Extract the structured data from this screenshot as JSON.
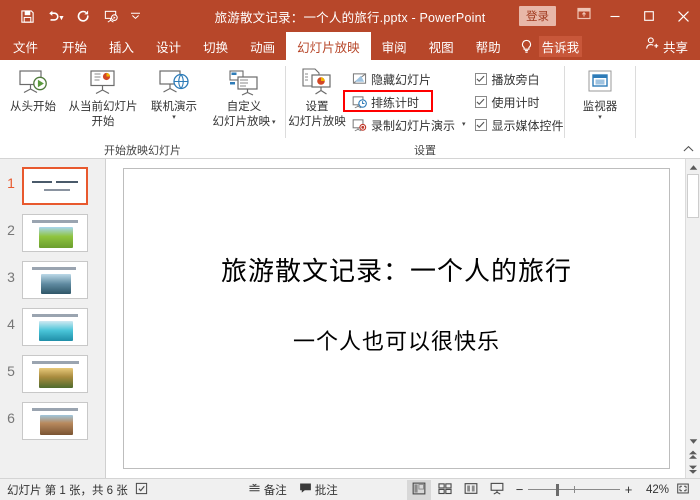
{
  "theme": {
    "accent": "#b7472a",
    "selection": "#e8592e",
    "highlight": "#ff0000"
  },
  "titlebar": {
    "document_title": "旅游散文记录：一个人的旅行.pptx  -  PowerPoint",
    "quick_access": [
      {
        "name": "save",
        "icon": "save-icon"
      },
      {
        "name": "undo",
        "icon": "undo-icon"
      },
      {
        "name": "redo",
        "icon": "redo-icon"
      },
      {
        "name": "start-from-beginning",
        "icon": "slideshow-icon"
      }
    ],
    "customize_qat": "customize-quick-access-toolbar-icon",
    "signin_label": "登录",
    "ribbon_display_options": "ribbon-display-options-icon",
    "minimize": "minimize-icon",
    "maximize": "maximize-icon",
    "close": "close-icon"
  },
  "tabs": {
    "items": [
      {
        "label": "文件",
        "active": false
      },
      {
        "label": "开始",
        "active": false
      },
      {
        "label": "插入",
        "active": false
      },
      {
        "label": "设计",
        "active": false
      },
      {
        "label": "切换",
        "active": false
      },
      {
        "label": "动画",
        "active": false
      },
      {
        "label": "幻灯片放映",
        "active": true
      },
      {
        "label": "审阅",
        "active": false
      },
      {
        "label": "视图",
        "active": false
      },
      {
        "label": "帮助",
        "active": false
      }
    ],
    "tell_me": "告诉我",
    "share": "共享"
  },
  "ribbon": {
    "groups": [
      {
        "title": "开始放映幻灯片",
        "big_buttons": [
          {
            "label_line1": "从头开始",
            "label_line2": "",
            "icon": "start-from-beginning-icon",
            "dropdown": false
          },
          {
            "label_line1": "从当前幻灯片",
            "label_line2": "开始",
            "icon": "start-from-current-slide-icon",
            "dropdown": false
          },
          {
            "label_line1": "联机演示",
            "label_line2": "",
            "icon": "present-online-icon",
            "dropdown": true
          },
          {
            "label_line1": "自定义",
            "label_line2": "幻灯片放映",
            "icon": "custom-slide-show-icon",
            "dropdown": true
          }
        ]
      },
      {
        "title": "设置",
        "big_buttons": [
          {
            "label_line1": "设置",
            "label_line2": "幻灯片放映",
            "icon": "set-up-slide-show-icon",
            "dropdown": false
          }
        ],
        "small_buttons": [
          {
            "label": "隐藏幻灯片",
            "icon": "hide-slide-icon",
            "dropdown": false,
            "highlighted": false
          },
          {
            "label": "排练计时",
            "icon": "rehearse-timings-icon",
            "dropdown": false,
            "highlighted": true
          },
          {
            "label": "录制幻灯片演示",
            "icon": "record-slide-show-icon",
            "dropdown": true,
            "highlighted": false
          }
        ],
        "checkboxes": [
          {
            "label": "播放旁白",
            "checked": true
          },
          {
            "label": "使用计时",
            "checked": true
          },
          {
            "label": "显示媒体控件",
            "checked": true
          }
        ]
      },
      {
        "title": "",
        "big_buttons": [
          {
            "label_line1": "监视器",
            "label_line2": "",
            "icon": "monitor-icon",
            "dropdown": true
          }
        ]
      }
    ],
    "collapse_icon": "collapse-ribbon-icon"
  },
  "slide_panel": {
    "thumbnails": [
      {
        "number": "1",
        "selected": true,
        "has_image": false,
        "image_color_a": "#ffffff",
        "image_color_b": "#ffffff"
      },
      {
        "number": "2",
        "selected": false,
        "has_image": true,
        "image_color_a": "#8fc43f",
        "image_color_b": "#6fa8dc"
      },
      {
        "number": "3",
        "selected": false,
        "has_image": true,
        "image_color_a": "#7fb8c8",
        "image_color_b": "#3a6f86"
      },
      {
        "number": "4",
        "selected": false,
        "has_image": true,
        "image_color_a": "#49c4d8",
        "image_color_b": "#1f8ea8"
      },
      {
        "number": "5",
        "selected": false,
        "has_image": true,
        "image_color_a": "#c9a94e",
        "image_color_b": "#5c7a3a"
      },
      {
        "number": "6",
        "selected": false,
        "has_image": true,
        "image_color_a": "#b98a5e",
        "image_color_b": "#7a5432"
      }
    ]
  },
  "slide": {
    "title": "旅游散文记录：一个人的旅行",
    "subtitle": "一个人也可以很快乐"
  },
  "scrollbar": {
    "up": "scroll-up-icon",
    "down": "scroll-down-icon",
    "previous_slide": "previous-slide-icon",
    "next_slide": "next-slide-icon"
  },
  "statusbar": {
    "slide_counter": "幻灯片 第 1 张，共 6 张",
    "accessibility_icon": "accessibility-check-icon",
    "notes_label": "备注",
    "comments_label": "批注",
    "views": [
      {
        "name": "normal-view",
        "icon": "normal-view-icon",
        "active": true
      },
      {
        "name": "slide-sorter-view",
        "icon": "slide-sorter-icon",
        "active": false
      },
      {
        "name": "reading-view",
        "icon": "reading-view-icon",
        "active": false
      },
      {
        "name": "slide-show-view",
        "icon": "slide-show-icon",
        "active": false
      }
    ],
    "zoom_out": "−",
    "zoom_in": "+",
    "zoom_level": "42%",
    "fit_to_window": "fit-slide-to-window-icon"
  }
}
